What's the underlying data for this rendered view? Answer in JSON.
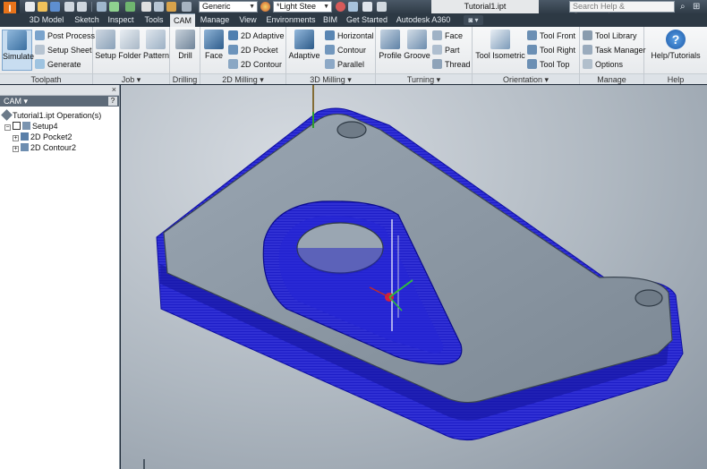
{
  "titlebar": {
    "material_combo": "Generic",
    "appearance_combo": "*Light Stee",
    "document_title": "Tutorial1.ipt",
    "search_placeholder": "Search Help & Commands...",
    "app_logo": "I"
  },
  "tabs": [
    {
      "label": "3D Model"
    },
    {
      "label": "Sketch"
    },
    {
      "label": "Inspect"
    },
    {
      "label": "Tools"
    },
    {
      "label": "CAM"
    },
    {
      "label": "Manage"
    },
    {
      "label": "View"
    },
    {
      "label": "Environments"
    },
    {
      "label": "BIM"
    },
    {
      "label": "Get Started"
    },
    {
      "label": "Autodesk A360"
    }
  ],
  "active_tab": "CAM",
  "ribbon": {
    "toolpath": {
      "label": "Toolpath",
      "simulate": "Simulate",
      "post_process": "Post Process",
      "setup_sheet": "Setup Sheet",
      "generate": "Generate"
    },
    "job": {
      "label": "Job ▾",
      "setup": "Setup",
      "folder": "Folder",
      "pattern": "Pattern"
    },
    "drilling": {
      "label": "Drilling",
      "drill": "Drill"
    },
    "milling2d": {
      "label": "2D Milling ▾",
      "face": "Face",
      "adaptive_2d": "2D Adaptive",
      "pocket_2d": "2D Pocket",
      "contour_2d": "2D Contour"
    },
    "milling3d": {
      "label": "3D Milling ▾",
      "adaptive": "Adaptive",
      "horizontal": "Horizontal",
      "contour": "Contour",
      "parallel": "Parallel"
    },
    "turning": {
      "label": "Turning ▾",
      "profile": "Profile",
      "groove": "Groove",
      "face": "Face",
      "part": "Part",
      "thread": "Thread"
    },
    "orientation": {
      "label": "Orientation ▾",
      "tool_isometric": "Tool Isometric",
      "tool_front": "Tool Front",
      "tool_right": "Tool Right",
      "tool_top": "Tool Top"
    },
    "manage": {
      "label": "Manage",
      "tool_library": "Tool Library",
      "task_manager": "Task Manager",
      "options": "Options"
    },
    "help": {
      "label": "Help",
      "help_tutorials": "Help/Tutorials"
    }
  },
  "browser": {
    "title": "CAM ▾",
    "help_label": "?",
    "close_label": "×",
    "tree": [
      {
        "label": "Tutorial1.ipt Operation(s)"
      },
      {
        "label": "Setup4"
      },
      {
        "label": "2D Pocket2"
      },
      {
        "label": "2D Contour2"
      }
    ]
  },
  "colors": {
    "toolpath_blue": "#1f1fd8",
    "part_gray": "#7f8c98",
    "active_tab_bg": "#e7eaed",
    "titlebar_bg": "#2f3b47"
  }
}
